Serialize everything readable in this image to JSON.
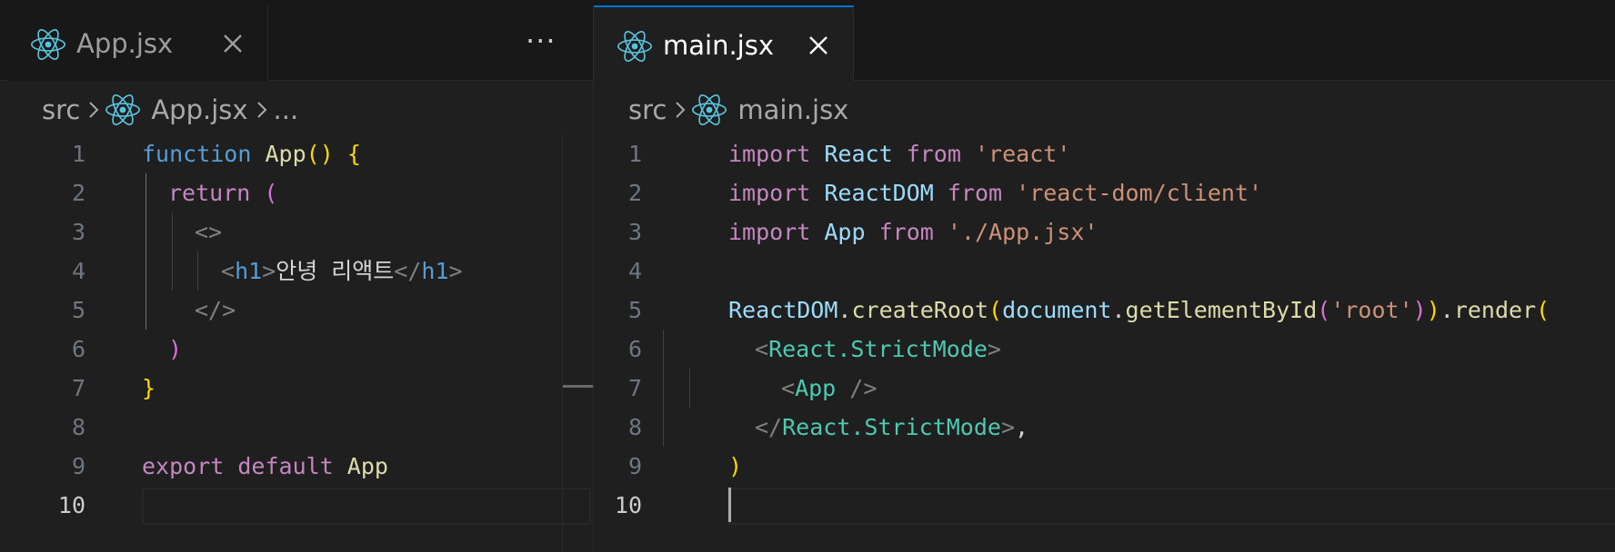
{
  "left_editor": {
    "tab_title": "App.jsx",
    "breadcrumb": {
      "folder": "src",
      "file": "App.jsx",
      "more": "..."
    },
    "more_actions": "···",
    "line_numbers": [
      "1",
      "2",
      "3",
      "4",
      "5",
      "6",
      "7",
      "8",
      "9",
      "10"
    ],
    "active_line": 10,
    "code": {
      "l1": {
        "kw": "function",
        "name": "App",
        "parens": "()",
        "brace": "{"
      },
      "l2": {
        "kw": "return",
        "paren": "("
      },
      "l3": {
        "frag_open": "<>"
      },
      "l4": {
        "lt": "<",
        "tag": "h1",
        "gt": ">",
        "text": "안녕 리액트",
        "close_lt": "</",
        "close_tag": "h1",
        "close_gt": ">"
      },
      "l5": {
        "frag_close": "</>"
      },
      "l6": {
        "paren": ")"
      },
      "l7": {
        "brace": "}"
      },
      "l9": {
        "kw1": "export",
        "kw2": "default",
        "name": "App"
      }
    }
  },
  "right_editor": {
    "tab_title": "main.jsx",
    "breadcrumb": {
      "folder": "src",
      "file": "main.jsx"
    },
    "line_numbers": [
      "1",
      "2",
      "3",
      "4",
      "5",
      "6",
      "7",
      "8",
      "9",
      "10"
    ],
    "active_line": 10,
    "code": {
      "l1": {
        "kw1": "import",
        "name": "React",
        "kw2": "from",
        "str": "'react'"
      },
      "l2": {
        "kw1": "import",
        "name": "ReactDOM",
        "kw2": "from",
        "str": "'react-dom/client'"
      },
      "l3": {
        "kw1": "import",
        "name": "App",
        "kw2": "from",
        "str": "'./App.jsx'"
      },
      "l5": {
        "obj": "ReactDOM",
        "dot1": ".",
        "fn1": "createRoot",
        "p1": "(",
        "obj2": "document",
        "dot2": ".",
        "fn2": "getElementById",
        "p2": "(",
        "str": "'root'",
        "p2c": ")",
        "p1c": ")",
        "dot3": ".",
        "fn3": "render",
        "p3": "("
      },
      "l6": {
        "lt": "<",
        "tag": "React.StrictMode",
        "gt": ">"
      },
      "l7": {
        "lt": "<",
        "tag": "App",
        "end": " />"
      },
      "l8": {
        "lt": "</",
        "tag": "React.StrictMode",
        "gt": ">",
        "comma": ","
      },
      "l9": {
        "paren": ")"
      }
    }
  },
  "colors": {
    "accent": "#0078d4",
    "react_icon": "#58c4dc"
  },
  "icons": {
    "tab_icon": "react-icon",
    "close": "close-icon",
    "more": "more-actions-icon",
    "chevron": "chevron-right-icon"
  }
}
